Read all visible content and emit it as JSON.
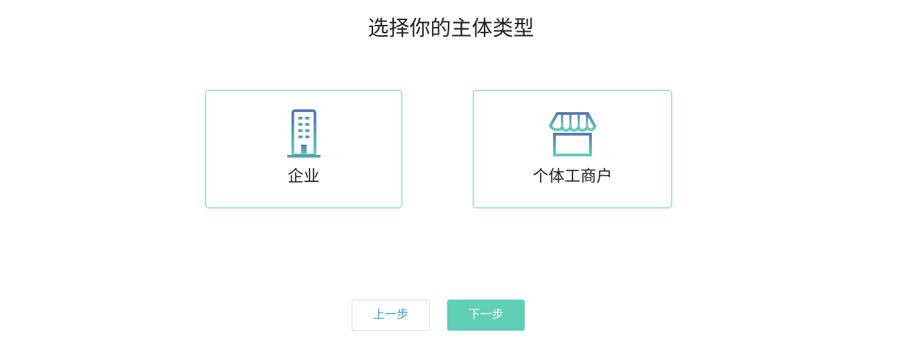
{
  "page": {
    "title": "选择你的主体类型"
  },
  "options": [
    {
      "label": "企业",
      "icon": "building-icon"
    },
    {
      "label": "个体工商户",
      "icon": "storefront-icon"
    }
  ],
  "actions": {
    "prev_label": "上一步",
    "next_label": "下一步"
  },
  "colors": {
    "accent": "#5fcfb5",
    "icon_gradient_top": "#5a77b8",
    "icon_gradient_bottom": "#5fcfb5",
    "link_blue": "#3a9fe0",
    "text": "#222222"
  }
}
